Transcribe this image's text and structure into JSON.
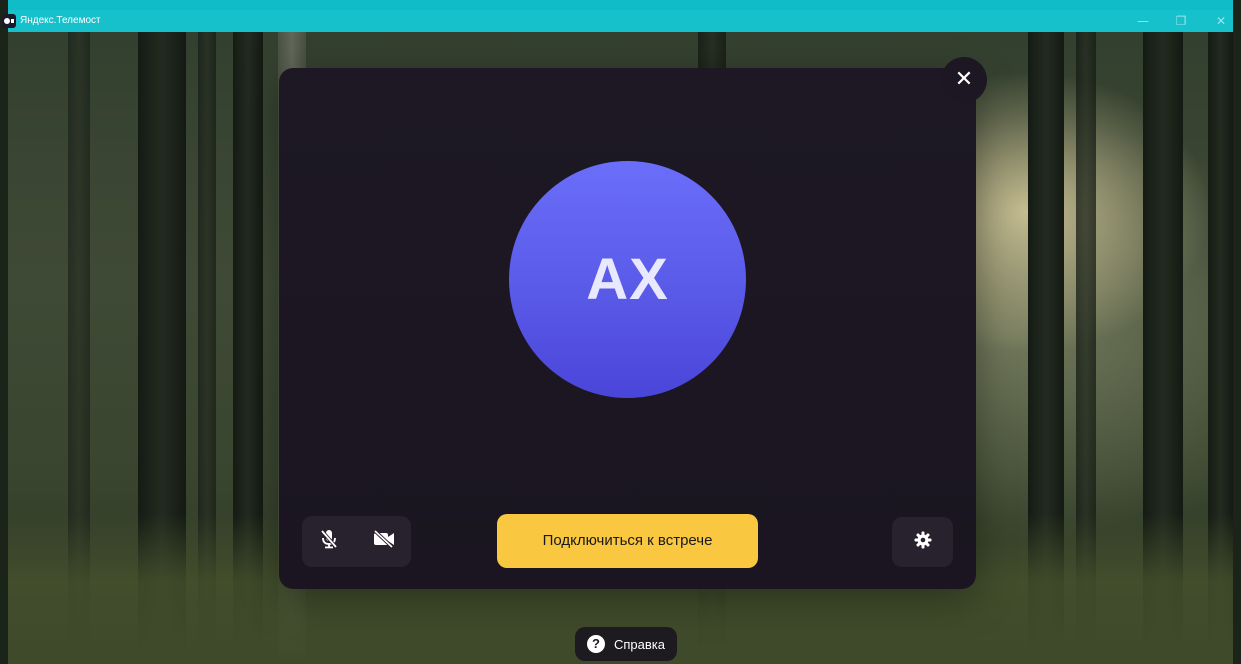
{
  "window": {
    "title": "Яндекс.Телемост",
    "minimize_glyph": "—",
    "maximize_glyph": "❐",
    "close_glyph": "✕"
  },
  "prejoin": {
    "avatar_initials": "AX",
    "close_glyph": "✕",
    "join_label": "Подключиться к встрече",
    "mic_state": "muted",
    "camera_state": "off",
    "icons": {
      "mic": "mic-off-icon",
      "camera": "camera-off-icon",
      "settings": "gear-icon",
      "close": "close-icon",
      "help": "question-icon"
    }
  },
  "footer": {
    "help_icon_glyph": "?",
    "help_label": "Справка"
  },
  "colors": {
    "titlebar": "#10bcc7",
    "modal_bg": "#1d1824",
    "avatar": "#5a5ae8",
    "join_button": "#f9c840",
    "control_bg": "#28222f"
  }
}
